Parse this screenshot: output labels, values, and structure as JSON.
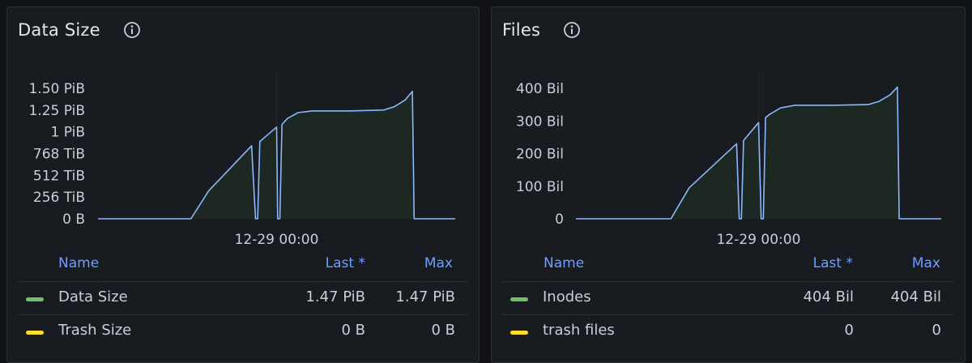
{
  "colors": {
    "line": "#8ab8ff",
    "fill": "#1e2a22",
    "legend_header": "#6e9fff",
    "series_green": "#73bf69",
    "series_yellow": "#fade2a"
  },
  "panels": [
    {
      "title": "Data Size",
      "info_icon": "info-circle-icon",
      "x_tick": "12-29 00:00",
      "legend": {
        "headers": {
          "name": "Name",
          "last": "Last *",
          "max": "Max"
        },
        "rows": [
          {
            "name": "Data Size",
            "last": "1.47 PiB",
            "max": "1.47 PiB",
            "color": "#73bf69"
          },
          {
            "name": "Trash Size",
            "last": "0 B",
            "max": "0 B",
            "color": "#fade2a"
          }
        ]
      }
    },
    {
      "title": "Files",
      "info_icon": "info-circle-icon",
      "x_tick": "12-29 00:00",
      "legend": {
        "headers": {
          "name": "Name",
          "last": "Last *",
          "max": "Max"
        },
        "rows": [
          {
            "name": "Inodes",
            "last": "404 Bil",
            "max": "404 Bil",
            "color": "#73bf69"
          },
          {
            "name": "trash files",
            "last": "0",
            "max": "0",
            "color": "#fade2a"
          }
        ]
      }
    }
  ],
  "chart_data": [
    {
      "type": "area",
      "title": "Data Size",
      "unit": "TiB",
      "y_tick_labels": [
        "1.50 PiB",
        "1.25 PiB",
        "1 PiB",
        "768 TiB",
        "512 TiB",
        "256 TiB",
        "0 B"
      ],
      "y_tick_values": [
        1536,
        1280,
        1024,
        768,
        512,
        256,
        0
      ],
      "ylim": [
        0,
        1536
      ],
      "x_tick_label": "12-29 00:00",
      "x_tick_pos": 0.5,
      "series": [
        {
          "name": "Data Size",
          "x": [
            0,
            0.26,
            0.31,
            0.43,
            0.441,
            0.447,
            0.453,
            0.5,
            0.503,
            0.509,
            0.515,
            0.53,
            0.56,
            0.6,
            0.7,
            0.8,
            0.83,
            0.86,
            0.88,
            0.885,
            1.0
          ],
          "y": [
            0,
            0,
            330,
            860,
            0,
            0,
            910,
            1080,
            0,
            0,
            1110,
            1180,
            1250,
            1270,
            1270,
            1280,
            1320,
            1400,
            1500,
            0,
            0
          ]
        }
      ]
    },
    {
      "type": "area",
      "title": "Files",
      "unit": "Bil",
      "y_tick_labels": [
        "400 Bil",
        "300 Bil",
        "200 Bil",
        "100 Bil",
        "0"
      ],
      "y_tick_values": [
        400,
        300,
        200,
        100,
        0
      ],
      "ylim": [
        0,
        400
      ],
      "x_tick_label": "12-29 00:00",
      "x_tick_pos": 0.5,
      "series": [
        {
          "name": "Inodes",
          "x": [
            0,
            0.26,
            0.31,
            0.44,
            0.447,
            0.453,
            0.459,
            0.5,
            0.507,
            0.513,
            0.519,
            0.53,
            0.56,
            0.6,
            0.7,
            0.8,
            0.83,
            0.86,
            0.88,
            0.885,
            1.0
          ],
          "y": [
            0,
            0,
            95,
            230,
            0,
            0,
            240,
            295,
            0,
            0,
            310,
            320,
            340,
            348,
            348,
            350,
            360,
            380,
            404,
            0,
            0
          ]
        }
      ]
    }
  ]
}
